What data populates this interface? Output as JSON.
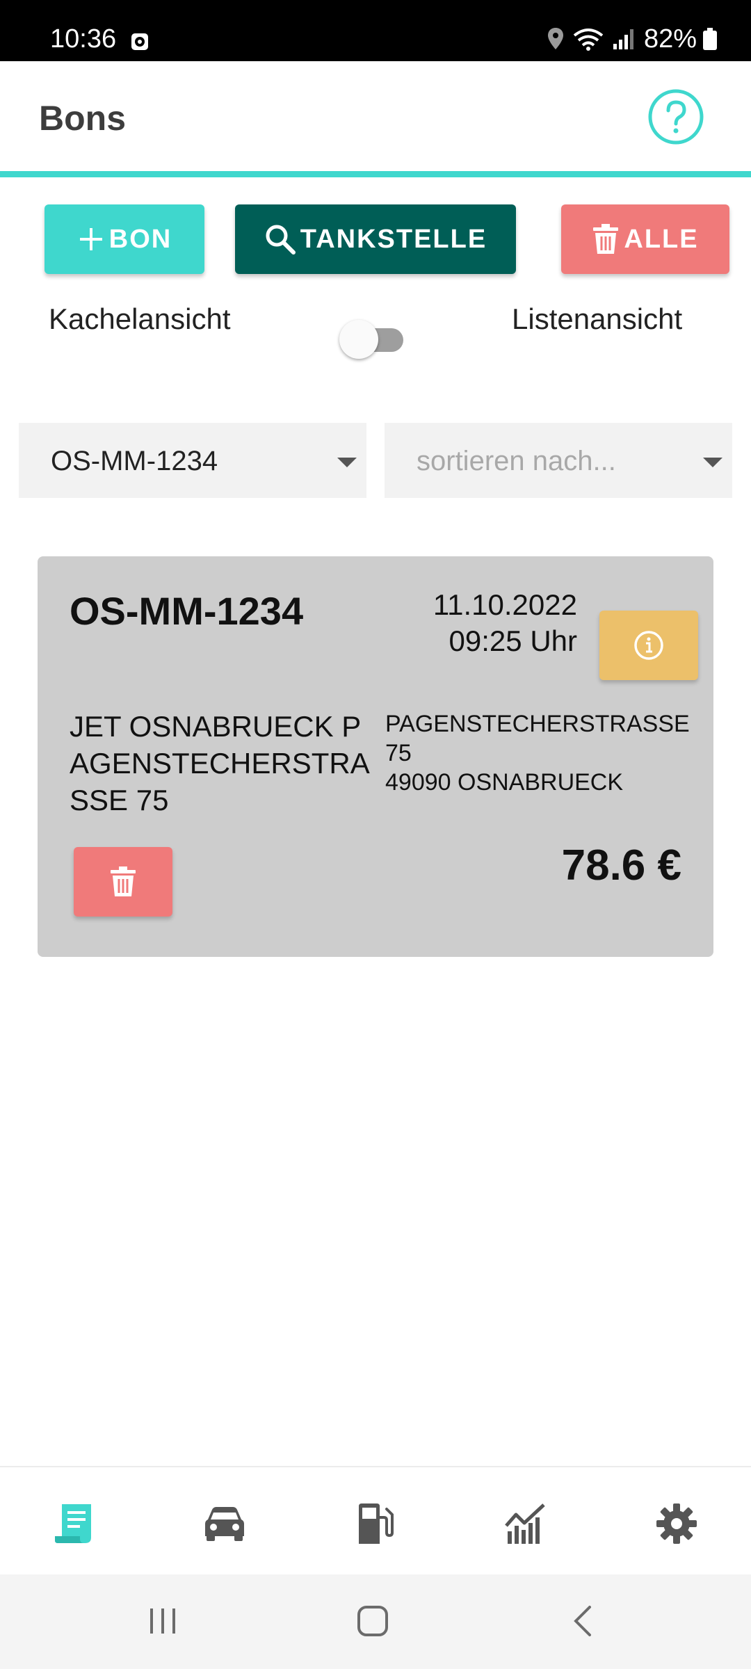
{
  "status_bar": {
    "time": "10:36",
    "battery": "82%",
    "icons": [
      "location-icon",
      "wifi-icon",
      "signal-icon",
      "battery-icon"
    ]
  },
  "header": {
    "title": "Bons",
    "help_icon": "help-circle-icon"
  },
  "actions": {
    "add_label": "BON",
    "search_label": "TANKSTELLE",
    "delete_all_label": "ALLE"
  },
  "view_toggle": {
    "left_label": "Kachelansicht",
    "right_label": "Listenansicht",
    "checked": false
  },
  "filters": {
    "vehicle_value": "OS-MM-1234",
    "sort_placeholder": "sortieren nach..."
  },
  "receipts": [
    {
      "plate": "OS-MM-1234",
      "date": "11.10.2022",
      "time": "09:25 Uhr",
      "station": "JET OSNABRUECK PAGENSTECHERSTRASSE 75",
      "address_line1": "PAGENSTECHERSTRASSE 75",
      "address_line2": "49090 OSNABRUECK",
      "price": "78.6 €"
    }
  ],
  "bottom_nav": [
    "receipt-icon",
    "car-icon",
    "fuel-icon",
    "chart-icon",
    "settings-icon"
  ],
  "colors": {
    "accent": "#3fd7cd",
    "dark_teal": "#005e56",
    "danger": "#f07a7a",
    "info": "#ecc06a",
    "card_bg": "#cdcdcd"
  }
}
